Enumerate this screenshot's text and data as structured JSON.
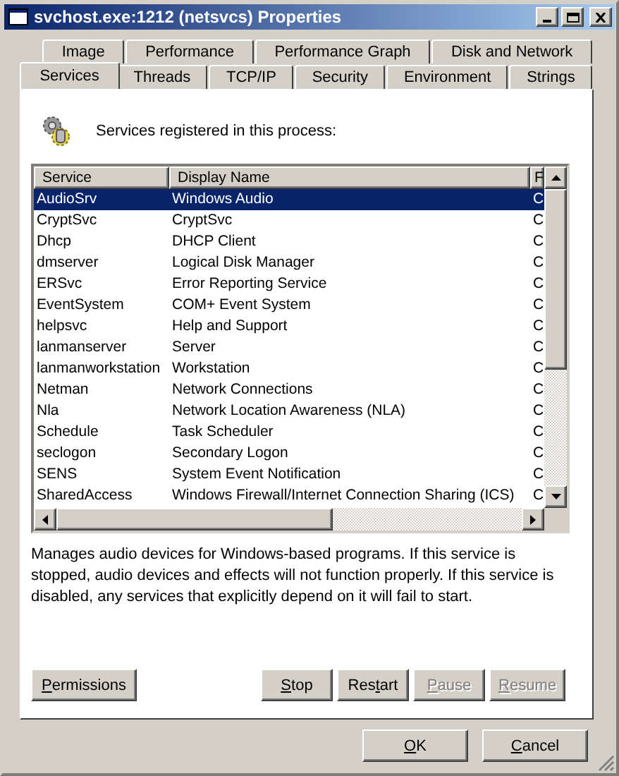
{
  "window": {
    "title": "svchost.exe:1212 (netsvcs) Properties",
    "controls": [
      {
        "kind": "minimize"
      },
      {
        "kind": "maximize"
      },
      {
        "kind": "close"
      }
    ]
  },
  "tabs": [
    [
      {
        "label": "Image",
        "selected": false
      },
      {
        "label": "Performance",
        "selected": false
      },
      {
        "label": "Performance Graph",
        "selected": false
      },
      {
        "label": "Disk and Network",
        "selected": false
      }
    ],
    [
      {
        "label": "Services",
        "selected": true
      },
      {
        "label": "Threads",
        "selected": false
      },
      {
        "label": "TCP/IP",
        "selected": false
      },
      {
        "label": "Security",
        "selected": false
      },
      {
        "label": "Environment",
        "selected": false
      },
      {
        "label": "Strings",
        "selected": false
      }
    ]
  ],
  "heading": "Services registered in this process:",
  "table": {
    "columns": [
      "Service",
      "Display Name",
      "F"
    ],
    "rows": [
      {
        "cells": [
          "AudioSrv",
          "Windows Audio",
          "C"
        ],
        "selected": true
      },
      {
        "cells": [
          "CryptSvc",
          "CryptSvc",
          "C"
        ],
        "selected": false
      },
      {
        "cells": [
          "Dhcp",
          "DHCP Client",
          "C"
        ],
        "selected": false
      },
      {
        "cells": [
          "dmserver",
          "Logical Disk Manager",
          "C"
        ],
        "selected": false
      },
      {
        "cells": [
          "ERSvc",
          "Error Reporting Service",
          "C"
        ],
        "selected": false
      },
      {
        "cells": [
          "EventSystem",
          "COM+ Event System",
          "C"
        ],
        "selected": false
      },
      {
        "cells": [
          "helpsvc",
          "Help and Support",
          "C"
        ],
        "selected": false
      },
      {
        "cells": [
          "lanmanserver",
          "Server",
          "C"
        ],
        "selected": false
      },
      {
        "cells": [
          "lanmanworkstation",
          "Workstation",
          "C"
        ],
        "selected": false
      },
      {
        "cells": [
          "Netman",
          "Network Connections",
          "C"
        ],
        "selected": false
      },
      {
        "cells": [
          "Nla",
          "Network Location Awareness (NLA)",
          "C"
        ],
        "selected": false
      },
      {
        "cells": [
          "Schedule",
          "Task Scheduler",
          "C"
        ],
        "selected": false
      },
      {
        "cells": [
          "seclogon",
          "Secondary Logon",
          "C"
        ],
        "selected": false
      },
      {
        "cells": [
          "SENS",
          "System Event Notification",
          "C"
        ],
        "selected": false
      },
      {
        "cells": [
          "SharedAccess",
          "Windows Firewall/Internet Connection Sharing (ICS)",
          "C"
        ],
        "selected": false
      }
    ]
  },
  "description": "Manages audio devices for Windows-based programs. If this service is stopped, audio devices and effects will not function properly. If this service is disabled, any services that explicitly depend on it will fail to start.",
  "service_buttons": [
    {
      "accel": "P",
      "after": "ermissions",
      "disabled": false
    },
    {
      "accel": "S",
      "after": "top",
      "disabled": false
    },
    {
      "before": "Res",
      "accel": "t",
      "after": "art",
      "disabled": false
    },
    {
      "accel": "P",
      "after": "ause",
      "disabled": true
    },
    {
      "accel": "R",
      "after": "esume",
      "disabled": true
    }
  ],
  "dialog_buttons": [
    {
      "accel": "O",
      "after": "K",
      "disabled": false
    },
    {
      "accel": "C",
      "after": "ancel",
      "disabled": false
    }
  ]
}
